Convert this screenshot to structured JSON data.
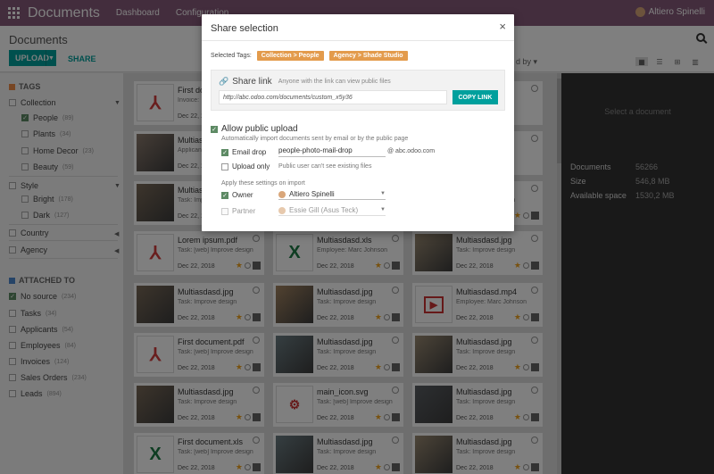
{
  "topbar": {
    "title": "Documents",
    "menus": [
      "Dashboard",
      "Configuration"
    ],
    "user": "Altiero Spinelli"
  },
  "control_panel": {
    "title": "Documents",
    "upload_label": "UPLOAD",
    "share_label": "SHARE",
    "sort_fragment": "d by"
  },
  "sidebar": {
    "tags_header": "TAGS",
    "collection": {
      "label": "Collection",
      "items": [
        {
          "label": "People",
          "count": "(89)",
          "checked": true
        },
        {
          "label": "Plants",
          "count": "(34)",
          "checked": false
        },
        {
          "label": "Home Decor",
          "count": "(23)",
          "checked": false
        },
        {
          "label": "Beauty",
          "count": "(59)",
          "checked": false
        }
      ]
    },
    "style": {
      "label": "Style",
      "items": [
        {
          "label": "Bright",
          "count": "(178)",
          "checked": false
        },
        {
          "label": "Dark",
          "count": "(127)",
          "checked": false
        }
      ]
    },
    "country": "Country",
    "agency": "Agency",
    "attached_header": "ATTACHED TO",
    "attached": [
      {
        "label": "No source",
        "count": "(234)",
        "checked": true
      },
      {
        "label": "Tasks",
        "count": "(34)",
        "checked": false
      },
      {
        "label": "Applicants",
        "count": "(54)",
        "checked": false
      },
      {
        "label": "Employees",
        "count": "(84)",
        "checked": false
      },
      {
        "label": "Invoices",
        "count": "(124)",
        "checked": false
      },
      {
        "label": "Sales Orders",
        "count": "(234)",
        "checked": false
      },
      {
        "label": "Leads",
        "count": "(894)",
        "checked": false
      }
    ]
  },
  "cards": [
    {
      "title": "First docum",
      "desc": "Invoice:",
      "date": "Dec 22, 2018",
      "thumb": "pdf"
    },
    {
      "title": "",
      "desc": "",
      "date": "",
      "thumb": "gray"
    },
    {
      "title": "",
      "desc": "",
      "date": "",
      "thumb": "gray"
    },
    {
      "title": "Multiasd",
      "desc": "Applicant:",
      "date": "Dec 22, 2018",
      "thumb": "photo"
    },
    {
      "title": "",
      "desc": "",
      "date": "",
      "thumb": "gray"
    },
    {
      "title": "",
      "desc": "",
      "date": "",
      "thumb": "gray"
    },
    {
      "title": "Multiasd",
      "desc": "Task: Improve design",
      "date": "Dec 22, 2018",
      "thumb": "photo"
    },
    {
      "title": "",
      "desc": "",
      "date": "",
      "thumb": "gray"
    },
    {
      "title": "",
      "desc": "Task: Improve design",
      "date": "Dec 22, 2018",
      "thumb": "gray"
    },
    {
      "title": "Lorem ipsum.pdf",
      "desc": "Task: [web] Improve design",
      "date": "Dec 22, 2018",
      "thumb": "pdf"
    },
    {
      "title": "Multiasdasd.xls",
      "desc": "Employee: Marc Johnson",
      "date": "Dec 22, 2018",
      "thumb": "xls"
    },
    {
      "title": "Multiasdasd.jpg",
      "desc": "Task: Improve design",
      "date": "Dec 22, 2018",
      "thumb": "photo"
    },
    {
      "title": "Multiasdasd.jpg",
      "desc": "Task: Improve design",
      "date": "Dec 22, 2018",
      "thumb": "photo"
    },
    {
      "title": "Multiasdasd.jpg",
      "desc": "Task: Improve design",
      "date": "Dec 22, 2018",
      "thumb": "photo"
    },
    {
      "title": "Multiasdasd.mp4",
      "desc": "Employee: Marc Johnson",
      "date": "Dec 22, 2018",
      "thumb": "video"
    },
    {
      "title": "First document.pdf",
      "desc": "Task: [web] Improve design",
      "date": "Dec 22, 2018",
      "thumb": "pdf"
    },
    {
      "title": "Multiasdasd.jpg",
      "desc": "Task: Improve design",
      "date": "Dec 22, 2018",
      "thumb": "photo"
    },
    {
      "title": "Multiasdasd.jpg",
      "desc": "Task: Improve design",
      "date": "Dec 22, 2018",
      "thumb": "photo"
    },
    {
      "title": "Multiasdasd.jpg",
      "desc": "Task: Improve design",
      "date": "Dec 22, 2018",
      "thumb": "photo"
    },
    {
      "title": "main_icon.svg",
      "desc": "Task: [web] Improve design",
      "date": "Dec 22, 2018",
      "thumb": "svg"
    },
    {
      "title": "Multiasdasd.jpg",
      "desc": "Task: Improve design",
      "date": "Dec 22, 2018",
      "thumb": "photo"
    },
    {
      "title": "First document.xls",
      "desc": "Task: [web] Improve design",
      "date": "Dec 22, 2018",
      "thumb": "xls"
    },
    {
      "title": "Multiasdasd.jpg",
      "desc": "Task: Improve design",
      "date": "Dec 22, 2018",
      "thumb": "photo"
    },
    {
      "title": "Multiasdasd.jpg",
      "desc": "Task: Improve design",
      "date": "Dec 22, 2018",
      "thumb": "photo"
    }
  ],
  "right_panel": {
    "placeholder": "Select a document",
    "stats": [
      {
        "label": "Documents",
        "value": "56266"
      },
      {
        "label": "Size",
        "value": "546,8 MB"
      },
      {
        "label": "Available space",
        "value": "1530,2 MB"
      }
    ]
  },
  "modal": {
    "title": "Share selection",
    "close": "×",
    "selected_tags_label": "Selected Tags:",
    "tags": [
      "Collection > People",
      "Agency > Shade Studio"
    ],
    "share_link": {
      "title": "Share link",
      "subtitle": "Anyone with the link can view public files",
      "url": "http://abc.odoo.com/documents/custom_x5y36",
      "copy_label": "COPY LINK"
    },
    "allow_upload": {
      "label": "Allow public upload",
      "desc": "Automatically import documents sent by email or by the public page",
      "email_label": "Email drop",
      "email_value": "people-photo-mail-drop",
      "email_domain": "@ abc.odoo.com",
      "upload_only_label": "Upload only",
      "upload_only_desc": "Public user can't see existing files",
      "apply_label": "Apply these settings on import",
      "owner_label": "Owner",
      "owner_value": "Altiero Spinelli",
      "partner_label": "Partner",
      "partner_value": "Essie Gill (Asus Teck)"
    }
  },
  "colors": {
    "brand": "#875a7b",
    "accent": "#00a09d",
    "tag": "#e39b4c",
    "check": "#5d8a64"
  }
}
